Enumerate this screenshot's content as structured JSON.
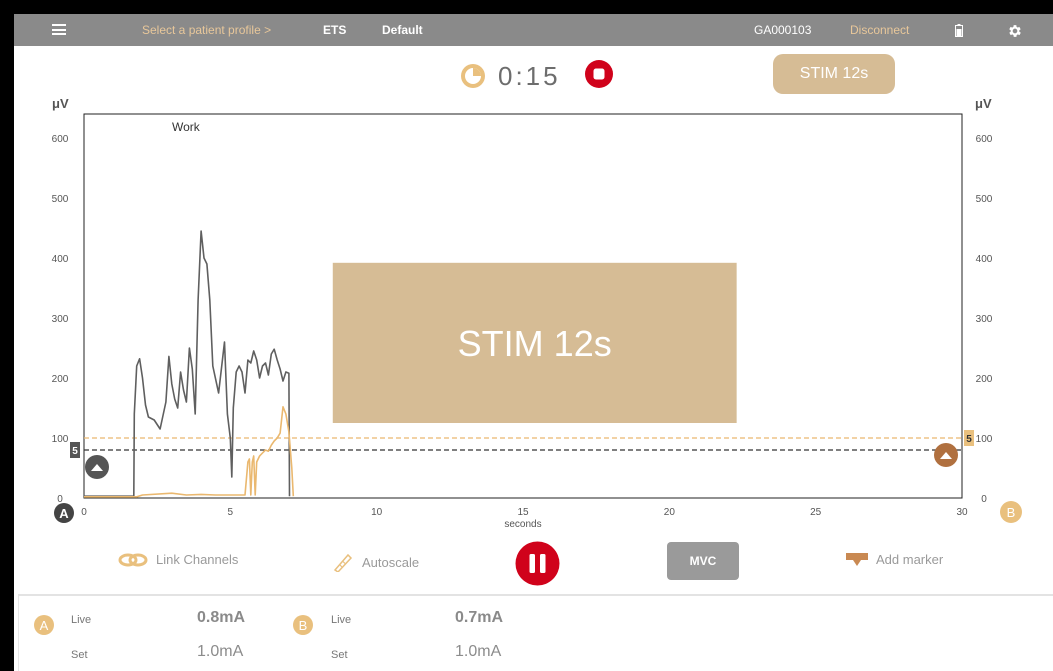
{
  "topbar": {
    "patient_link": "Select a patient profile  >",
    "mode": "ETS",
    "profile": "Default",
    "device_id": "GA000103",
    "disconnect": "Disconnect"
  },
  "timer": "0:15",
  "stim_button_label": "STIM 12s",
  "colors": {
    "accent": "#e9c07e",
    "stim_box": "#d6bc95",
    "danger": "#d0021b",
    "channel_a": "#5f5f5f",
    "channel_b": "#eab86f"
  },
  "chart_data": {
    "type": "line",
    "xlabel": "seconds",
    "ylabel_left": "μV",
    "ylabel_right": "μV",
    "xlim": [
      0,
      30
    ],
    "ylim": [
      0,
      640
    ],
    "x_ticks": [
      0,
      5,
      10,
      15,
      20,
      25,
      30
    ],
    "y_ticks": [
      0,
      100,
      200,
      300,
      400,
      500,
      600
    ],
    "phase_label": "Work",
    "overlay_label": "STIM 12s",
    "overlay_range": {
      "x": [
        8.5,
        22.3
      ],
      "y": [
        125,
        392
      ]
    },
    "threshold_a": {
      "value": 80,
      "label": "5"
    },
    "threshold_b": {
      "value": 100,
      "label": "5"
    },
    "series": [
      {
        "name": "A",
        "x": [
          0,
          1.7,
          1.72,
          1.8,
          1.9,
          2.0,
          2.1,
          2.2,
          2.4,
          2.6,
          2.8,
          2.9,
          3.0,
          3.1,
          3.2,
          3.3,
          3.4,
          3.5,
          3.6,
          3.7,
          3.8,
          3.9,
          4.0,
          4.1,
          4.2,
          4.3,
          4.4,
          4.6,
          4.8,
          4.9,
          5.0,
          5.05,
          5.1,
          5.2,
          5.3,
          5.4,
          5.5,
          5.6,
          5.7,
          5.8,
          5.9,
          6.0,
          6.1,
          6.2,
          6.3,
          6.4,
          6.5,
          6.6,
          6.7,
          6.8,
          6.9,
          7.0,
          7.02
        ],
        "values": [
          3,
          3,
          140,
          220,
          232,
          200,
          155,
          135,
          130,
          115,
          160,
          236,
          190,
          165,
          150,
          210,
          180,
          160,
          250,
          215,
          140,
          330,
          445,
          400,
          390,
          330,
          220,
          175,
          260,
          140,
          100,
          35,
          150,
          210,
          220,
          210,
          175,
          230,
          225,
          245,
          230,
          200,
          220,
          225,
          205,
          240,
          248,
          230,
          215,
          195,
          210,
          208,
          3
        ]
      },
      {
        "name": "B",
        "x": [
          0,
          1.8,
          2.0,
          3.0,
          3.5,
          4.0,
          4.5,
          5.0,
          5.3,
          5.4,
          5.5,
          5.6,
          5.65,
          5.7,
          5.75,
          5.8,
          5.85,
          5.9,
          6.0,
          6.1,
          6.2,
          6.3,
          6.4,
          6.5,
          6.6,
          6.7,
          6.8,
          6.9,
          7.0,
          7.1,
          7.15
        ],
        "values": [
          2,
          2,
          5,
          8,
          5,
          6,
          5,
          5,
          5,
          5,
          5,
          60,
          65,
          5,
          60,
          70,
          5,
          60,
          70,
          75,
          80,
          78,
          88,
          95,
          100,
          108,
          152,
          140,
          110,
          50,
          3
        ]
      }
    ]
  },
  "controls": {
    "link_channels": "Link Channels",
    "autoscale": "Autoscale",
    "mvc": "MVC",
    "add_marker": "Add marker"
  },
  "channels": [
    {
      "badge": "A",
      "live_label": "Live",
      "live_value": "0.8mA",
      "set_label": "Set",
      "set_value": "1.0mA"
    },
    {
      "badge": "B",
      "live_label": "Live",
      "live_value": "0.7mA",
      "set_label": "Set",
      "set_value": "1.0mA"
    }
  ]
}
